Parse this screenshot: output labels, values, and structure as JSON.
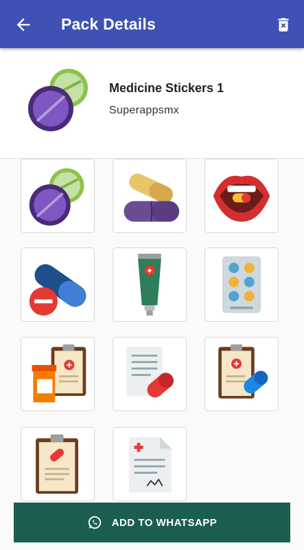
{
  "appbar": {
    "title": "Pack Details",
    "back_icon": "arrow-back-icon",
    "delete_icon": "delete-icon"
  },
  "pack": {
    "name": "Medicine Stickers 1",
    "publisher": "Superappsmx",
    "tray_icon": "pills-tray-icon"
  },
  "stickers": [
    {
      "icon": "round-pills-icon"
    },
    {
      "icon": "capsule-pills-icon"
    },
    {
      "icon": "mouth-pill-icon"
    },
    {
      "icon": "capsule-tablet-icon"
    },
    {
      "icon": "ointment-tube-icon"
    },
    {
      "icon": "blister-pack-icon"
    },
    {
      "icon": "clipboard-bottle-icon"
    },
    {
      "icon": "prescription-capsule-icon"
    },
    {
      "icon": "clipboard-capsule-icon"
    },
    {
      "icon": "clipboard-pill-icon"
    },
    {
      "icon": "prescription-document-icon"
    }
  ],
  "add_button": {
    "label": "ADD TO WHATSAPP",
    "icon": "whatsapp-icon"
  },
  "colors": {
    "appbar": "#3f51b5",
    "button": "#1b5e51"
  }
}
